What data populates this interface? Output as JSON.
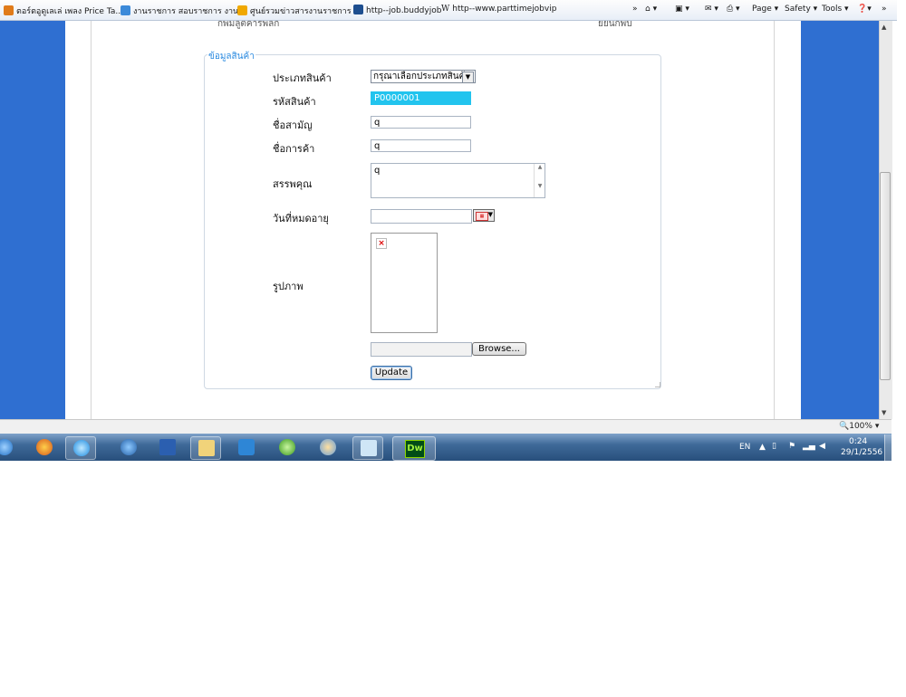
{
  "favorites": [
    {
      "label": "ตอร์ตอูดูเลเล่ เพลง Price Ta...",
      "color": "#e07b1a"
    },
    {
      "label": "งานราชการ สอบราชการ งาน...",
      "color": "#3c8ad9"
    },
    {
      "label": "ศูนย์รวมข่าวสารงานราชการ ...",
      "color": "#f0a800"
    },
    {
      "label": "http--job.buddyjob",
      "color": "#1d4e8f"
    },
    {
      "label": "http--www.parttimejobvip",
      "color": "#555555"
    }
  ],
  "command_bar": {
    "page": "Page ▾",
    "safety": "Safety ▾",
    "tools": "Tools ▾"
  },
  "cutoff": {
    "left": "กพมลูตคารพลก",
    "right": "ยยนกพบ"
  },
  "form": {
    "legend": "ข้อมูลสินค้า",
    "fields": {
      "type_label": "ประเภทสินค้า",
      "type_value": "กรุณาเลือกประเภทสินค้า",
      "code_label": "รหัสสินค้า",
      "code_value": "P0000001",
      "common_name_label": "ชื่อสามัญ",
      "common_name_value": "q",
      "trade_name_label": "ชื่อการค้า",
      "trade_name_value": "q",
      "properties_label": "สรรพคุณ",
      "properties_value": "q",
      "expiry_label": "วันที่หมดอายุ",
      "expiry_value": "",
      "image_label": "รูปภาพ"
    },
    "browse_label": "Browse...",
    "update_label": "Update"
  },
  "status": {
    "zoom": "100%"
  },
  "taskbar": {
    "dw_label": "Dw",
    "lang": "EN",
    "time": "0:24",
    "date": "29/1/2556"
  }
}
